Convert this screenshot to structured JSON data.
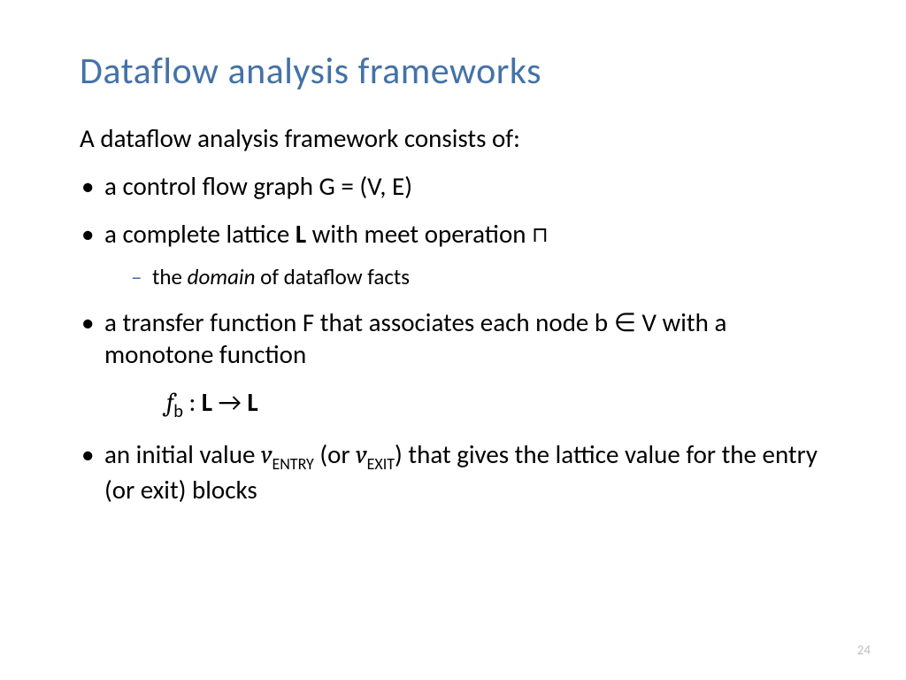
{
  "title": "Dataflow analysis frameworks",
  "intro": "A dataflow analysis framework consists of:",
  "bullets": {
    "b1": "a control flow graph G = (V, E)",
    "b2_pre": "a complete lattice ",
    "b2_L": "L",
    "b2_post": " with meet operation ",
    "b2_meet": "⊓",
    "b2_sub_pre": "the ",
    "b2_sub_domain": "domain",
    "b2_sub_post": " of dataflow facts",
    "b3_pre": "a transfer function F that associates each node b ",
    "b3_in": "∈",
    "b3_post": " V with a monotone function",
    "formula_f": "f",
    "formula_sub": "b",
    "formula_colon": " : ",
    "formula_L1": "L",
    "formula_arrow": "  →  ",
    "formula_L2": "L",
    "b4_pre": "an initial value ",
    "b4_v1": "v",
    "b4_entry": "ENTRY",
    "b4_or": " (or ",
    "b4_v2": "v",
    "b4_exit": "EXIT",
    "b4_post": ") that gives the lattice value for the entry (or exit) blocks"
  },
  "page_number": "24"
}
